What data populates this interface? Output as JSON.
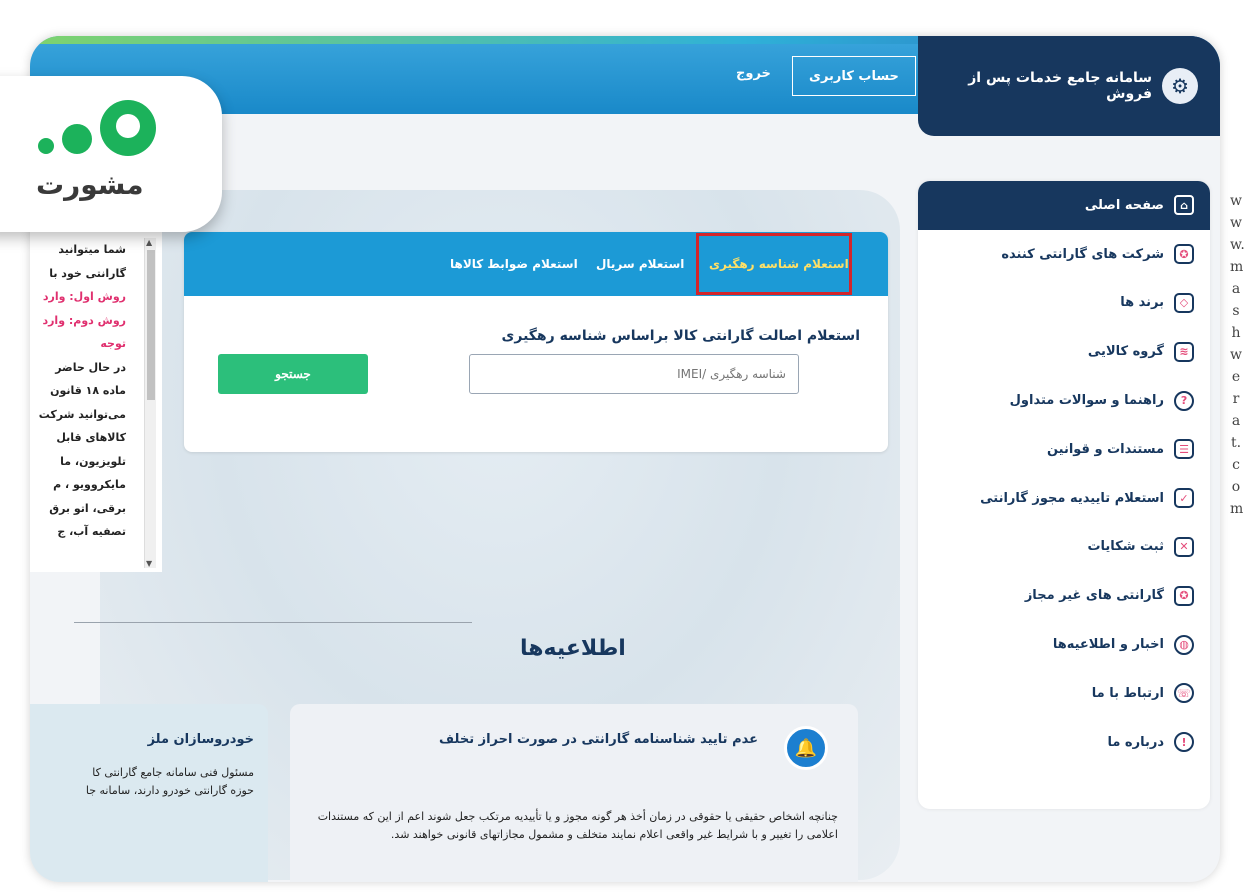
{
  "header": {
    "site_title": "سامانه جامع خدمات پس از فروش",
    "account_button": "حساب کاربری",
    "logout_link": "خروج"
  },
  "sidebar": {
    "items": [
      {
        "label": "صفحه اصلی",
        "icon": "home-icon",
        "glyph": "⌂"
      },
      {
        "label": "شرکت های گارانتی کننده",
        "icon": "badge-icon",
        "glyph": "✪"
      },
      {
        "label": "برند ها",
        "icon": "tag-icon",
        "glyph": "◇"
      },
      {
        "label": "گروه کالایی",
        "icon": "layers-icon",
        "glyph": "≋"
      },
      {
        "label": "راهنما و سوالات متداول",
        "icon": "question-icon",
        "glyph": "?"
      },
      {
        "label": "مستندات و قوانین",
        "icon": "document-icon",
        "glyph": "☰"
      },
      {
        "label": "استعلام تاییدیه مجوز گارانتی",
        "icon": "certificate-icon",
        "glyph": "✓"
      },
      {
        "label": "ثبت شکایات",
        "icon": "complaint-icon",
        "glyph": "✕"
      },
      {
        "label": "گارانتی های غیر مجاز",
        "icon": "shield-icon",
        "glyph": "✪"
      },
      {
        "label": "اخبار و اطلاعیه‌ها",
        "icon": "globe-icon",
        "glyph": "◍"
      },
      {
        "label": "ارتباط با ما",
        "icon": "phone-icon",
        "glyph": "☏"
      },
      {
        "label": "درباره ما",
        "icon": "info-icon",
        "glyph": "!"
      }
    ]
  },
  "inquiry": {
    "tabs": {
      "tracking": "استعلام شناسه رهگیری",
      "serial": "استعلام سریال",
      "criteria": "استعلام ضوابط کالاها"
    },
    "heading": "استعلام اصالت گارانتی کالا براساس شناسه رهگیری",
    "input_placeholder": "شناسه رهگیری /IMEI",
    "search_button": "جستجو"
  },
  "left_panel": {
    "lines": [
      {
        "text": "شما میتوانید",
        "pink": false
      },
      {
        "text": "گارانتی خود با",
        "pink": false
      },
      {
        "text": "روش اول: وارد",
        "pink": true
      },
      {
        "text": "روش دوم: وارد",
        "pink": true
      },
      {
        "text": "توجه",
        "pink": true
      },
      {
        "text": "در حال حاضر",
        "pink": false
      },
      {
        "text": "ماده ۱۸ قانون",
        "pink": false
      },
      {
        "text": "می‌توانید شرکت",
        "pink": false
      },
      {
        "text": "کالاهای قابل",
        "pink": false
      },
      {
        "text": "تلویزیون، ما",
        "pink": false
      },
      {
        "text": "مایکروویو ، م",
        "pink": false
      },
      {
        "text": "برقی، اتو برق",
        "pink": false
      },
      {
        "text": "تصفیه آب، ج",
        "pink": false
      }
    ]
  },
  "announcements": {
    "title": "اطلاعیه‌ها",
    "card1": {
      "heading": "عدم تایید شناسنامه گارانتی در صورت احراز تخلف",
      "body": "چنانچه اشخاص حقیقی یا حقوقی در زمان أخذ هر گونه مجوز و یا تأییدیه مرتکب جعل شوند اعم از این که مستندات اعلامی را تغییر و با شرایط غیر واقعی اعلام نمایند متخلف و مشمول مجازاتهای قانونی خواهند شد."
    },
    "card2": {
      "heading": "خودروسازان ملز",
      "line1": "مسئول فنی سامانه جامع گارانتی کا",
      "line2": "حوزه گارانتی خودرو دارند، سامانه جا"
    }
  },
  "watermark": {
    "site": "www.mashwerat.com",
    "logo_text": "مشورت"
  },
  "colors": {
    "navy": "#17375e",
    "blue": "#1c9ad6",
    "green": "#2cbf7b",
    "highlight_red": "#d4252a",
    "active_tab_text": "#ffe066"
  }
}
